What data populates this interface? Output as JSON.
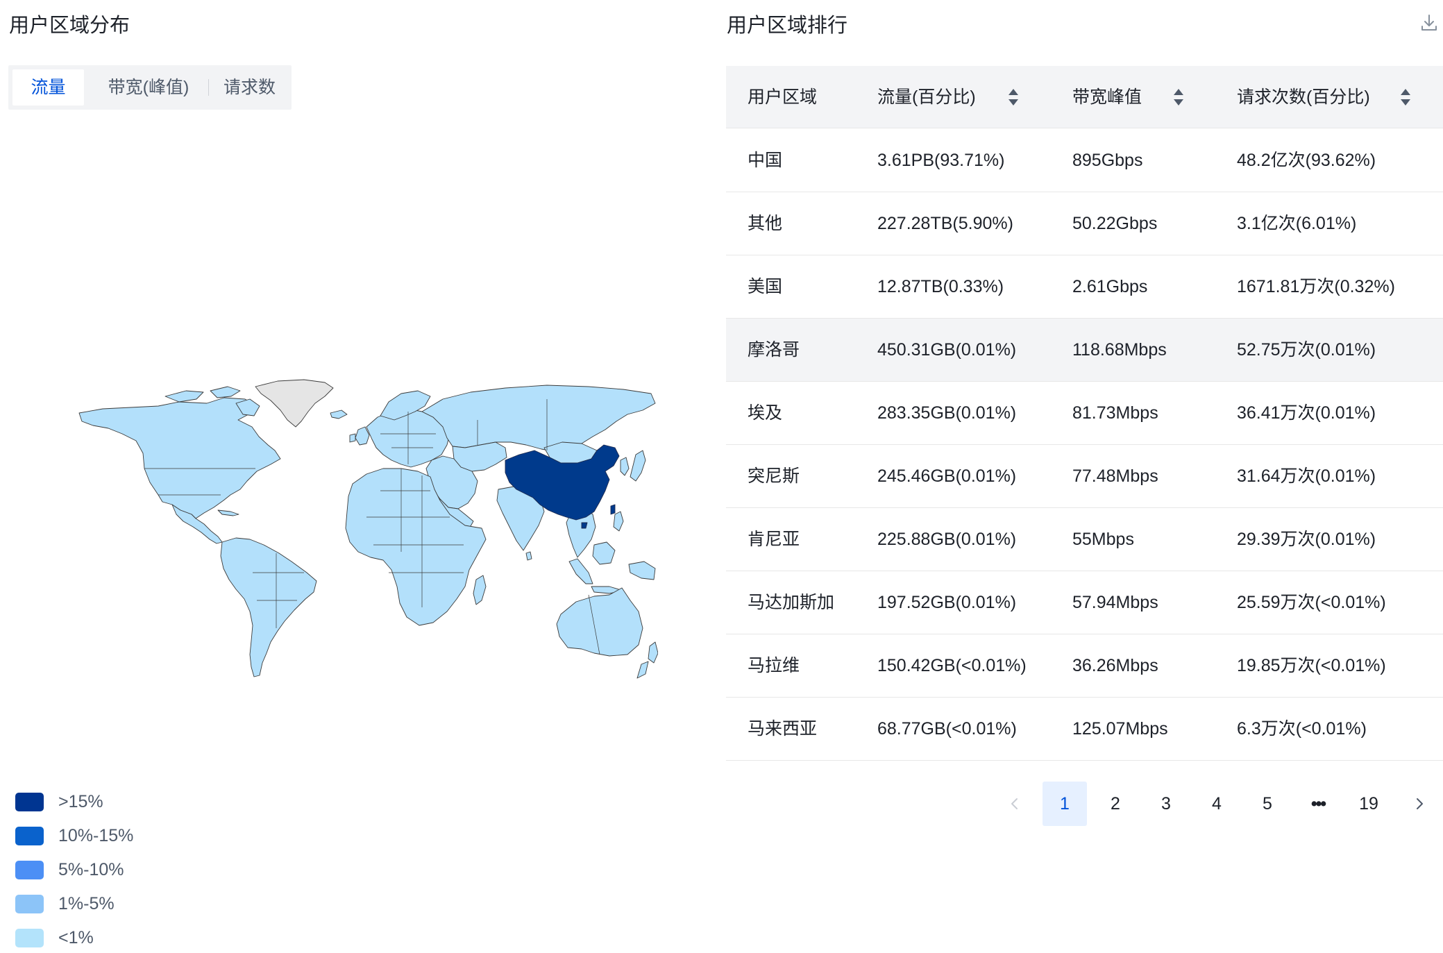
{
  "left_panel": {
    "title": "用户区域分布",
    "tabs": [
      {
        "label": "流量",
        "active": true
      },
      {
        "label": "带宽(峰值)",
        "active": false
      },
      {
        "label": "请求数",
        "active": false
      }
    ],
    "map": {
      "highlight_color": "#003a8c",
      "base_color": "#b3e0fb",
      "no_data_color": "#e5e5e5"
    },
    "legend": [
      {
        "label": ">15%",
        "color": "#003591"
      },
      {
        "label": "10%-15%",
        "color": "#0a62cc"
      },
      {
        "label": "5%-10%",
        "color": "#4c8ff5"
      },
      {
        "label": "1%-5%",
        "color": "#8cc4f8"
      },
      {
        "label": "<1%",
        "color": "#b3e3fb"
      }
    ]
  },
  "right_panel": {
    "title": "用户区域排行",
    "download_icon": "download-icon",
    "columns": [
      "用户区域",
      "流量(百分比)",
      "带宽峰值",
      "请求次数(百分比)"
    ],
    "rows": [
      [
        "中国",
        "3.61PB(93.71%)",
        "895Gbps",
        "48.2亿次(93.62%)"
      ],
      [
        "其他",
        "227.28TB(5.90%)",
        "50.22Gbps",
        "3.1亿次(6.01%)"
      ],
      [
        "美国",
        "12.87TB(0.33%)",
        "2.61Gbps",
        "1671.81万次(0.32%)"
      ],
      [
        "摩洛哥",
        "450.31GB(0.01%)",
        "118.68Mbps",
        "52.75万次(0.01%)"
      ],
      [
        "埃及",
        "283.35GB(0.01%)",
        "81.73Mbps",
        "36.41万次(0.01%)"
      ],
      [
        "突尼斯",
        "245.46GB(0.01%)",
        "77.48Mbps",
        "31.64万次(0.01%)"
      ],
      [
        "肯尼亚",
        "225.88GB(0.01%)",
        "55Mbps",
        "29.39万次(0.01%)"
      ],
      [
        "马达加斯加",
        "197.52GB(0.01%)",
        "57.94Mbps",
        "25.59万次(<0.01%)"
      ],
      [
        "马拉维",
        "150.42GB(<0.01%)",
        "36.26Mbps",
        "19.85万次(<0.01%)"
      ],
      [
        "马来西亚",
        "68.77GB(<0.01%)",
        "125.07Mbps",
        "6.3万次(<0.01%)"
      ]
    ],
    "hover_row": 3,
    "pagination": {
      "pages": [
        "1",
        "2",
        "3",
        "4",
        "5",
        "•••",
        "19"
      ],
      "current": "1",
      "accent": "#0052d9"
    }
  }
}
